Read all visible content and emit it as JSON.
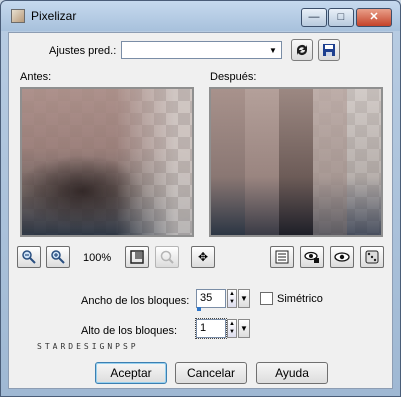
{
  "window": {
    "title": "Pixelizar",
    "min_glyph": "—",
    "max_glyph": "□",
    "close_glyph": "✕"
  },
  "presets": {
    "label": "Ajustes pred.:",
    "value": "",
    "dropdown_glyph": "▼"
  },
  "preview": {
    "before_label": "Antes:",
    "after_label": "Después:"
  },
  "toolbar": {
    "zoom": "100%",
    "zoom_out_icon": "zoom-out-icon",
    "zoom_in_icon": "zoom-in-icon",
    "fit_icon": "fit-window-icon",
    "reset_zoom_icon": "reset-zoom-icon",
    "pan_icon": "pan-icon",
    "move_glyph": "✥"
  },
  "settings": {
    "width_label": "Ancho de los bloques:",
    "width_value": "35",
    "symmetric_label": "Simétrico",
    "symmetric_checked": false,
    "height_label": "Alto de los bloques:",
    "height_value": "1",
    "spin_up": "▲",
    "spin_down": "▼",
    "dd_glyph": "▼"
  },
  "watermark": "STARDESIGNPSP",
  "buttons": {
    "ok": "Aceptar",
    "cancel": "Cancelar",
    "help": "Ayuda"
  },
  "colors": {
    "accent": "#3c7fb1",
    "title_bar": "#b9cde3",
    "client_bg": "#f0f0f0"
  }
}
